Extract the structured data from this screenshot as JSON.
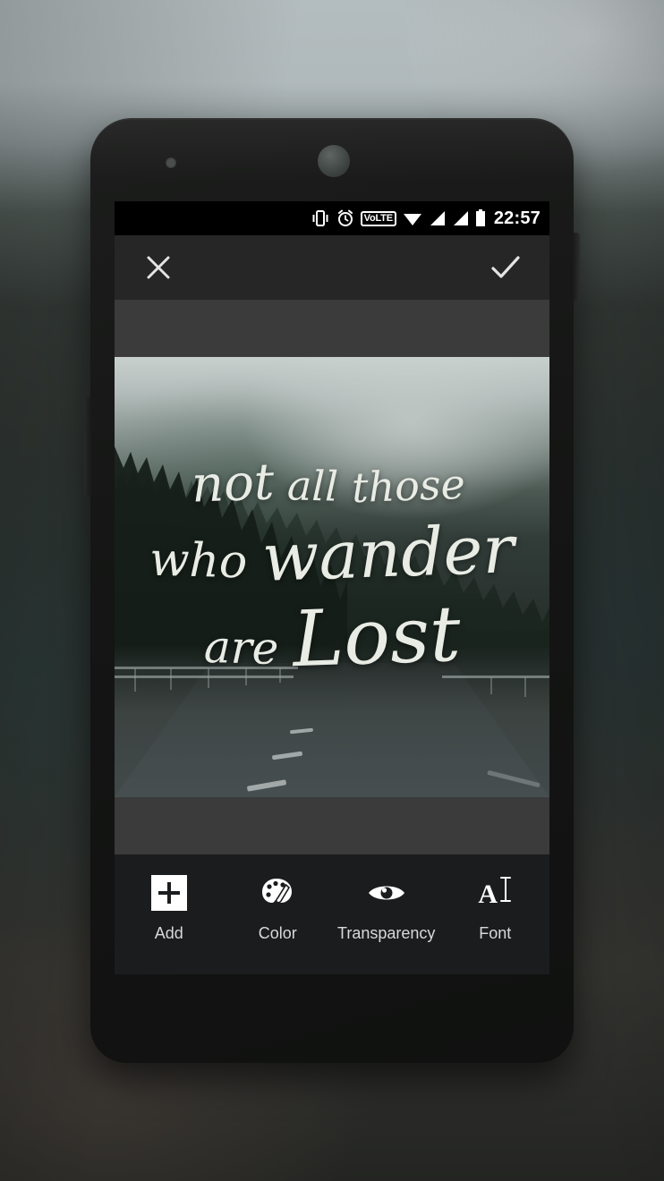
{
  "app": {
    "name": "photo-text-editor"
  },
  "device": {
    "type": "android-phone",
    "sensor_icon": "proximity-sensor",
    "camera_icon": "front-camera",
    "power_button": "power-button",
    "volume_button": "volume-button"
  },
  "status_bar": {
    "clock": "22:57",
    "icons": [
      {
        "name": "vibrate-icon",
        "label": "vibrate"
      },
      {
        "name": "alarm-icon",
        "label": "alarm"
      },
      {
        "name": "volte-icon",
        "label": "VoLTE"
      },
      {
        "name": "wifi-icon",
        "label": "wifi"
      },
      {
        "name": "signal-sim1-icon",
        "label": "signal 1"
      },
      {
        "name": "signal-sim2-icon",
        "label": "signal 2"
      },
      {
        "name": "battery-icon",
        "label": "battery"
      }
    ],
    "volte_text": "LTE",
    "volte_prefix": "Vo"
  },
  "action_bar": {
    "close_label": "Close",
    "confirm_label": "Done"
  },
  "canvas": {
    "background_color": "#3b3b3b",
    "photo_alt": "foggy forest mountain road",
    "quote": {
      "line1_small": "not",
      "line1_mid": "all",
      "line1_end": "those",
      "line2_small": "who",
      "line2_big": "wander",
      "line3_small": "are",
      "line3_big": "Lost",
      "full_text": "not all those who wander are Lost",
      "text_color": "#e8ece4"
    }
  },
  "tools": {
    "background_color": "#1b1c1e",
    "items": [
      {
        "id": "add",
        "label": "Add",
        "icon": "plus-square-icon"
      },
      {
        "id": "color",
        "label": "Color",
        "icon": "palette-icon"
      },
      {
        "id": "transparency",
        "label": "Transparency",
        "icon": "eye-icon"
      },
      {
        "id": "font",
        "label": "Font",
        "icon": "font-a-cursor-icon",
        "letter": "A",
        "caret": "I"
      }
    ]
  }
}
